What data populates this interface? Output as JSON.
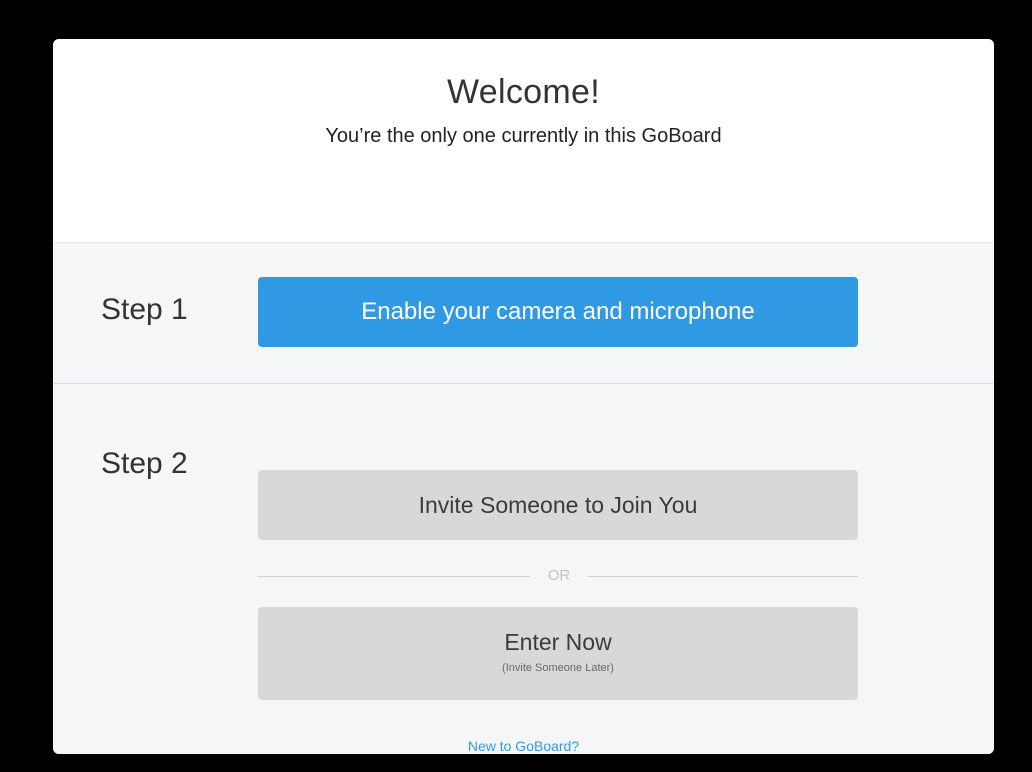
{
  "header": {
    "title": "Welcome!",
    "subtitle": "You’re the only one currently in this GoBoard"
  },
  "step1": {
    "label": "Step 1",
    "button_label": "Enable your camera and microphone"
  },
  "step2": {
    "label": "Step 2",
    "invite_button_label": "Invite Someone to Join You",
    "divider_text": "OR",
    "enter_button_label": "Enter Now",
    "enter_button_sublabel": "(Invite Someone Later)"
  },
  "footer": {
    "link_text": "New to GoBoard?"
  },
  "colors": {
    "accent": "#2f9ae3",
    "secondary_button": "#d8d8d8",
    "backdrop": "#000000"
  }
}
